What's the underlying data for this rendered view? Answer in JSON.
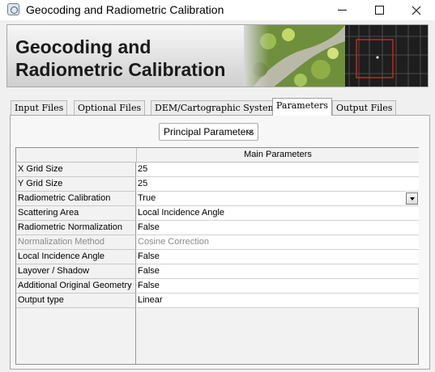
{
  "window": {
    "title": "Geocoding and Radiometric Calibration",
    "controls": {
      "minimize": "minimize",
      "maximize": "maximize",
      "close": "close"
    }
  },
  "banner": {
    "title": "Geocoding and Radiometric Calibration"
  },
  "tabs": [
    {
      "label": "Input Files",
      "active": false
    },
    {
      "label": "Optional Files",
      "active": false
    },
    {
      "label": "DEM/Cartographic System",
      "active": false
    },
    {
      "label": "Parameters",
      "active": true
    },
    {
      "label": "Output Files",
      "active": false
    }
  ],
  "parameters": {
    "section_selector": {
      "selected": "Principal Parameters"
    },
    "table": {
      "column_header": "Main Parameters",
      "rows": [
        {
          "label": "X Grid Size",
          "value": "25",
          "enabled": true,
          "control": "text"
        },
        {
          "label": "Y Grid Size",
          "value": "25",
          "enabled": true,
          "control": "text"
        },
        {
          "label": "Radiometric Calibration",
          "value": "True",
          "enabled": true,
          "control": "combo"
        },
        {
          "label": "Scattering Area",
          "value": "Local Incidence Angle",
          "enabled": true,
          "control": "text"
        },
        {
          "label": "Radiometric Normalization",
          "value": "False",
          "enabled": true,
          "control": "text"
        },
        {
          "label": "Normalization Method",
          "value": "Cosine Correction",
          "enabled": false,
          "control": "text"
        },
        {
          "label": "Local Incidence Angle",
          "value": "False",
          "enabled": true,
          "control": "text"
        },
        {
          "label": "Layover / Shadow",
          "value": "False",
          "enabled": true,
          "control": "text"
        },
        {
          "label": "Additional Original Geometry",
          "value": "False",
          "enabled": true,
          "control": "text"
        },
        {
          "label": "Output type",
          "value": "Linear",
          "enabled": true,
          "control": "text"
        }
      ]
    }
  },
  "colors": {
    "highlight_box": "#e02020",
    "panel_background": "#f7f7f7"
  }
}
